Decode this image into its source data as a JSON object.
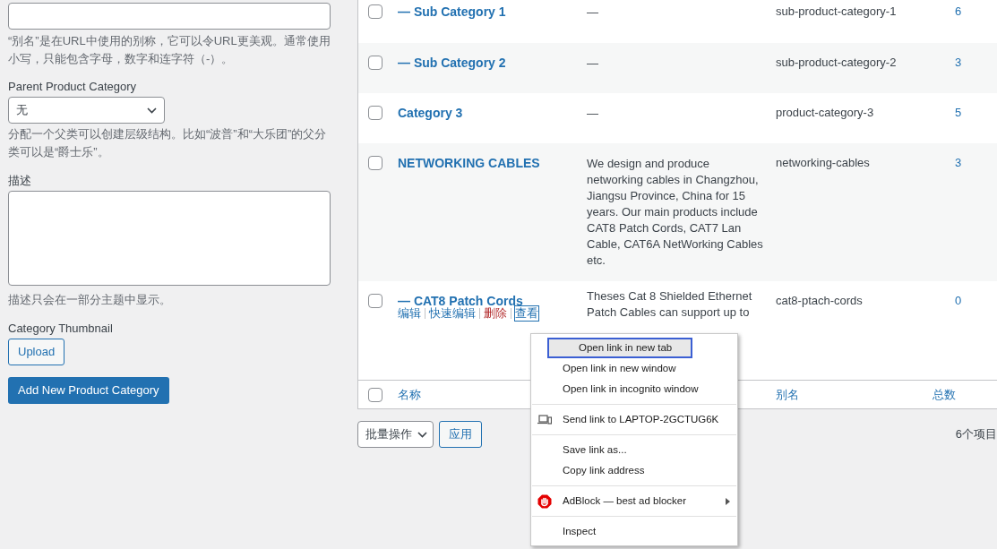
{
  "form": {
    "slug_help": "“别名”是在URL中使用的别称，它可以令URL更美观。通常使用小写，只能包含字母，数字和连字符（-）。",
    "parent_label": "Parent Product Category",
    "parent_value": "无",
    "parent_help": "分配一个父类可以创建层级结构。比如“波普”和“大乐团”的父分类可以是“爵士乐”。",
    "description_label": "描述",
    "description_help": "描述只会在一部分主题中显示。",
    "thumbnail_label": "Category Thumbnail",
    "upload_button": "Upload",
    "submit_button": "Add New Product Category"
  },
  "table": {
    "rows": [
      {
        "name": "— Sub Category 1",
        "description": "—",
        "slug": "sub-product-category-1",
        "count": "6",
        "checked": false
      },
      {
        "name": "— Sub Category 2",
        "description": "—",
        "slug": "sub-product-category-2",
        "count": "3",
        "checked": false
      },
      {
        "name": "Category 3",
        "description": "—",
        "slug": "product-category-3",
        "count": "5",
        "checked": false
      },
      {
        "name": "NETWORKING CABLES",
        "description": "We design and produce networking cables in Changzhou, Jiangsu Province, China for 15 years. Our main products include CAT8 Patch Cords, CAT7 Lan Cable, CAT6A NetWorking Cables etc.",
        "slug": "networking-cables",
        "count": "3",
        "checked": false
      },
      {
        "name": "— CAT8 Patch Cords",
        "description": "Theses Cat 8 Shielded Ethernet Patch Cables can support up to",
        "slug": "cat8-ptach-cords",
        "count": "0",
        "checked": false,
        "actions": [
          {
            "label": "编辑",
            "kind": "link"
          },
          {
            "label": "快速编辑",
            "kind": "link"
          },
          {
            "label": "删除",
            "kind": "delete"
          },
          {
            "label": "查看",
            "kind": "focused"
          }
        ]
      }
    ],
    "footer": {
      "checked": false,
      "name": "名称",
      "slug": "别名",
      "count": "总数"
    }
  },
  "bulk": {
    "select": "批量操作",
    "apply": "应用",
    "item_count": "6个项目"
  },
  "context_menu": [
    {
      "kind": "item",
      "label": "Open link in new tab",
      "selected": true
    },
    {
      "kind": "item",
      "label": "Open link in new window",
      "selected": false
    },
    {
      "kind": "item",
      "label": "Open link in incognito window",
      "selected": false
    },
    {
      "kind": "separator"
    },
    {
      "kind": "device",
      "label": "Send link to LAPTOP-2GCTUG6K",
      "selected": false
    },
    {
      "kind": "separator"
    },
    {
      "kind": "item",
      "label": "Save link as...",
      "selected": false
    },
    {
      "kind": "item",
      "label": "Copy link address",
      "selected": false
    },
    {
      "kind": "separator"
    },
    {
      "kind": "extension",
      "label": "AdBlock — best ad blocker",
      "selected": false
    },
    {
      "kind": "separator"
    },
    {
      "kind": "item",
      "label": "Inspect",
      "selected": false
    }
  ]
}
